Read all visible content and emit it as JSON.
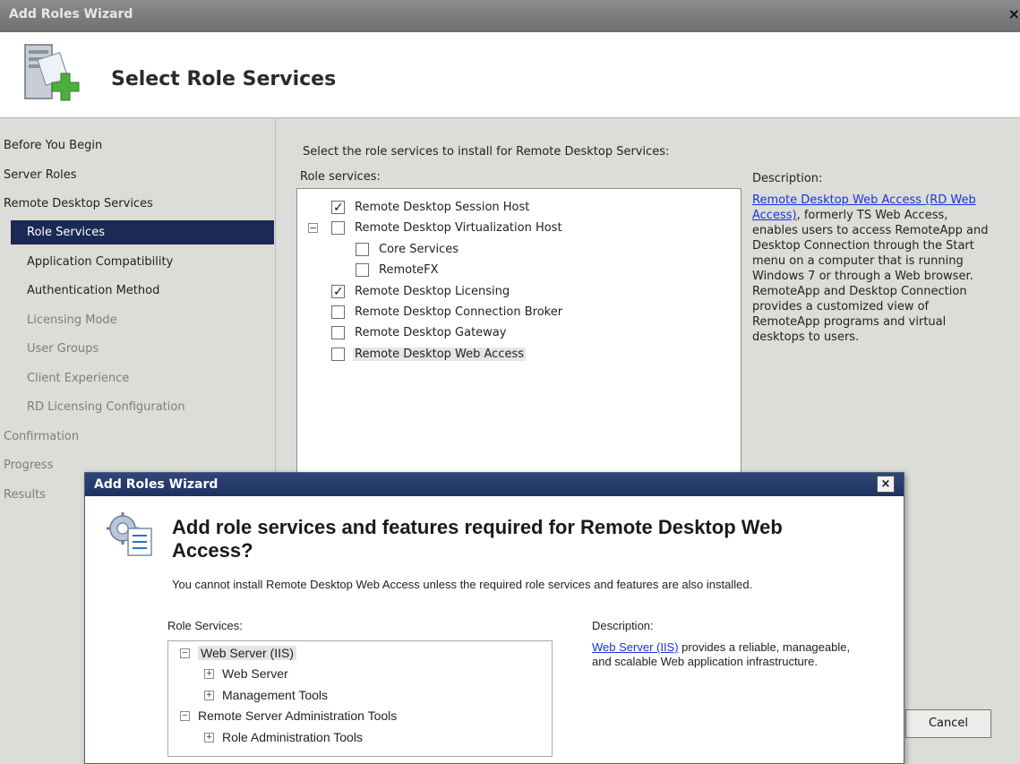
{
  "window": {
    "title": "Add Roles Wizard",
    "close_glyph": "×",
    "page_title": "Select Role Services"
  },
  "nav": {
    "items": [
      {
        "label": "Before You Begin",
        "state": "normal"
      },
      {
        "label": "Server Roles",
        "state": "normal"
      },
      {
        "label": "Remote Desktop Services",
        "state": "normal"
      },
      {
        "label": "Role Services",
        "state": "selected"
      },
      {
        "label": "Application Compatibility",
        "state": "normal"
      },
      {
        "label": "Authentication Method",
        "state": "normal"
      },
      {
        "label": "Licensing Mode",
        "state": "disabled"
      },
      {
        "label": "User Groups",
        "state": "disabled"
      },
      {
        "label": "Client Experience",
        "state": "disabled"
      },
      {
        "label": "RD Licensing Configuration",
        "state": "disabled"
      },
      {
        "label": "Confirmation",
        "state": "disabled"
      },
      {
        "label": "Progress",
        "state": "disabled"
      },
      {
        "label": "Results",
        "state": "disabled"
      }
    ]
  },
  "main": {
    "instruction": "Select the role services to install for Remote Desktop Services:",
    "role_services_label": "Role services:",
    "services": [
      {
        "label": "Remote Desktop Session Host",
        "checked": true
      },
      {
        "label": "Remote Desktop Virtualization Host",
        "checked": false,
        "expander": "−"
      },
      {
        "label": "Core Services",
        "checked": false
      },
      {
        "label": "RemoteFX",
        "checked": false
      },
      {
        "label": "Remote Desktop Licensing",
        "checked": true
      },
      {
        "label": "Remote Desktop Connection Broker",
        "checked": false
      },
      {
        "label": "Remote Desktop Gateway",
        "checked": false
      },
      {
        "label": "Remote Desktop Web Access",
        "checked": false,
        "highlighted": true
      }
    ],
    "description_label": "Description:",
    "description_link": "Remote Desktop Web Access (RD Web Access)",
    "description_text": ", formerly TS Web Access, enables users to access RemoteApp and Desktop Connection through the Start menu on a computer that is running Windows 7 or through a Web browser. RemoteApp and Desktop Connection provides a customized view of RemoteApp programs and virtual desktops to users.",
    "cancel_label": "Cancel"
  },
  "dialog": {
    "title": "Add Roles Wizard",
    "close_glyph": "×",
    "heading": "Add role services and features required for Remote Desktop Web Access?",
    "body": "You cannot install Remote Desktop Web Access unless the required role services and features are also installed.",
    "role_services_label": "Role Services:",
    "description_label": "Description:",
    "tree": [
      {
        "label": "Web Server (IIS)",
        "expander": "−",
        "level": 0,
        "selected": true
      },
      {
        "label": "Web Server",
        "expander": "+",
        "level": 1
      },
      {
        "label": "Management Tools",
        "expander": "+",
        "level": 1
      },
      {
        "label": "Remote Server Administration Tools",
        "expander": "−",
        "level": 0
      },
      {
        "label": "Role Administration Tools",
        "expander": "+",
        "level": 1
      }
    ],
    "description_link": "Web Server (IIS)",
    "description_text": " provides a reliable, manageable, and scalable Web application infrastructure."
  },
  "colors": {
    "nav_selected": "#1b2a55",
    "link": "#1a33d6",
    "dialog_titlebar": "#1e3260"
  }
}
